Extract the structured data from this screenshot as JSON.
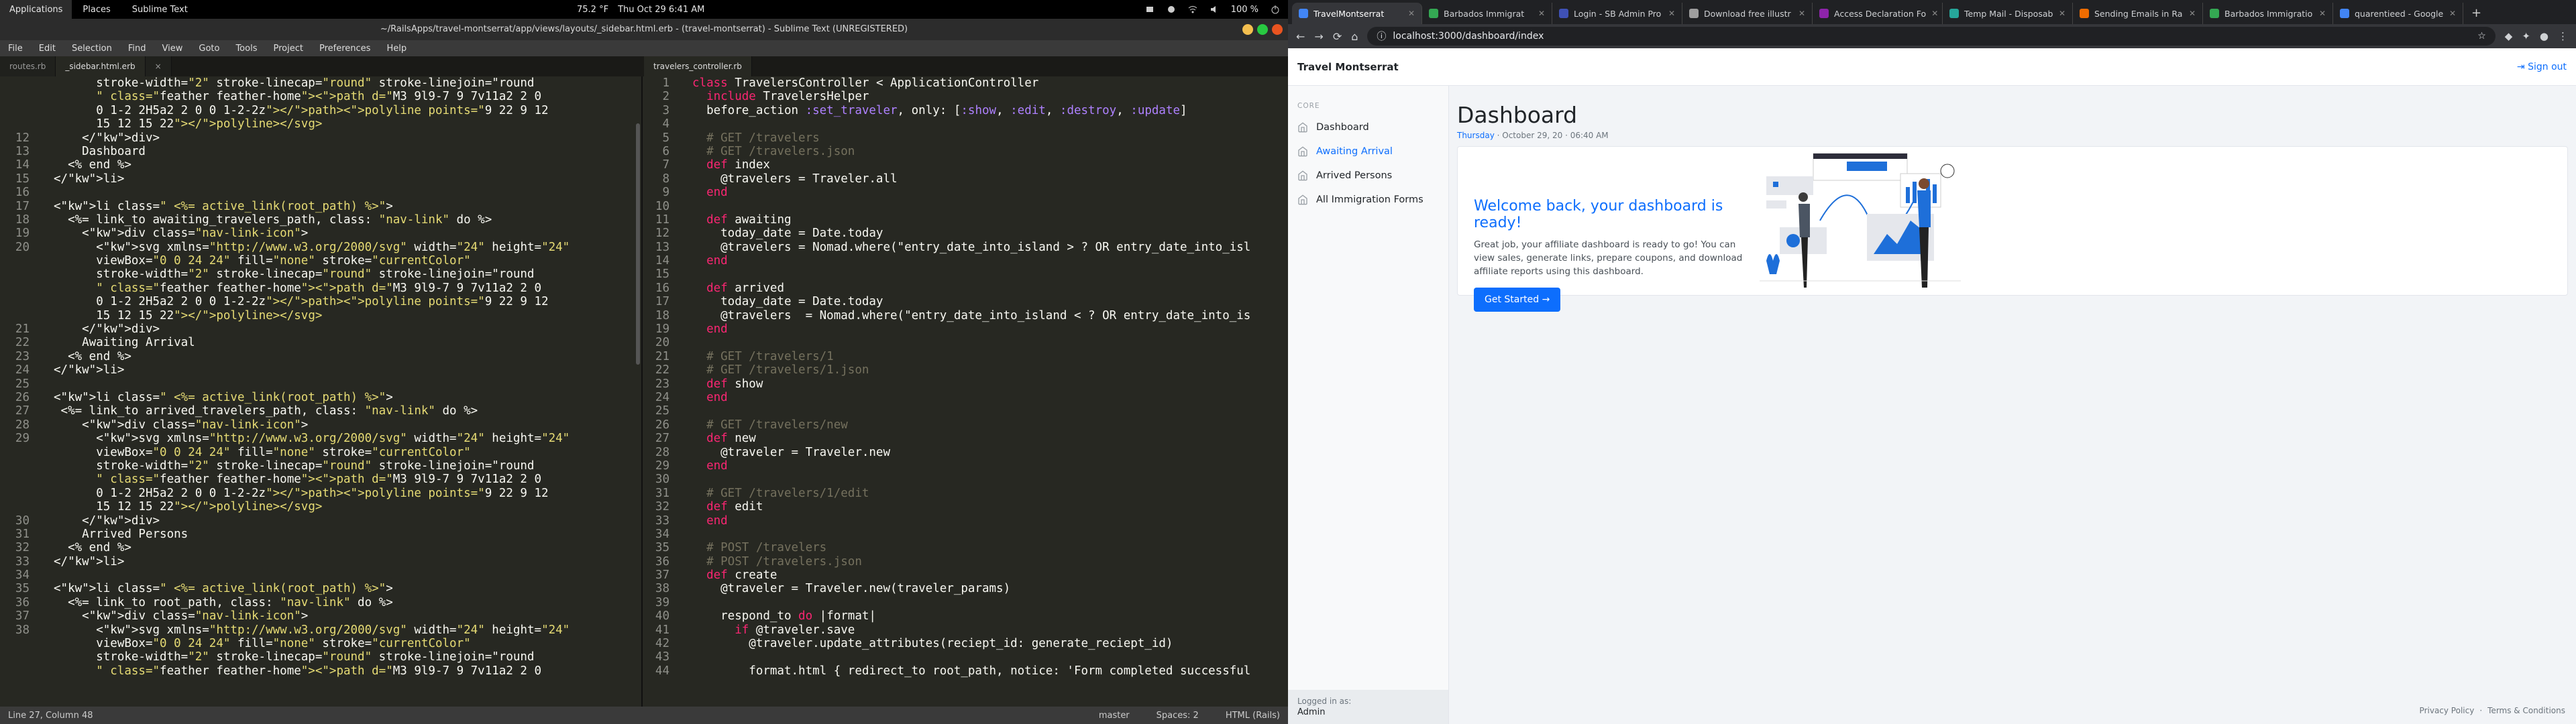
{
  "topbar": {
    "applications": "Applications",
    "places": "Places",
    "sublime": "Sublime Text",
    "weather": "75.2 °F",
    "clock": "Thu Oct 29  6:41 AM",
    "battery": "100 %"
  },
  "sublime": {
    "title": "~/RailsApps/travel-montserrat/app/views/layouts/_sidebar.html.erb - (travel-montserrat) - Sublime Text (UNREGISTERED)",
    "menu": [
      "File",
      "Edit",
      "Selection",
      "Find",
      "View",
      "Goto",
      "Tools",
      "Project",
      "Preferences",
      "Help"
    ],
    "left_tabs": [
      "routes.rb",
      "_sidebar.html.erb",
      "×"
    ],
    "right_tabs": [
      "travelers_controller.rb"
    ],
    "status": {
      "position": "Line 27, Column 48",
      "branch": "master",
      "spaces": "Spaces: 2",
      "syntax": "HTML (Rails)"
    },
    "left_lines": [
      {
        "n": "",
        "t": "      stroke-width=\"2\" stroke-linecap=\"round\" stroke-linejoin=\"round"
      },
      {
        "n": "",
        "t": "      \" class=\"feather feather-home\"><path d=\"M3 9l9-7 9 7v11a2 2 0"
      },
      {
        "n": "",
        "t": "      0 1-2 2H5a2 2 0 0 1-2-2z\"></path><polyline points=\"9 22 9 12"
      },
      {
        "n": "",
        "t": "      15 12 15 22\"></polyline></svg>"
      },
      {
        "n": "12",
        "t": "    </div>"
      },
      {
        "n": "13",
        "t": "    Dashboard"
      },
      {
        "n": "14",
        "t": "  <% end %>"
      },
      {
        "n": "15",
        "t": "</li>"
      },
      {
        "n": "16",
        "t": ""
      },
      {
        "n": "17",
        "t": "<li class=\" <%= active_link(root_path) %>\">"
      },
      {
        "n": "18",
        "t": "  <%= link_to awaiting_travelers_path, class: \"nav-link\" do %>"
      },
      {
        "n": "19",
        "t": "    <div class=\"nav-link-icon\">"
      },
      {
        "n": "20",
        "t": "      <svg xmlns=\"http://www.w3.org/2000/svg\" width=\"24\" height=\"24\""
      },
      {
        "n": "",
        "t": "      viewBox=\"0 0 24 24\" fill=\"none\" stroke=\"currentColor\""
      },
      {
        "n": "",
        "t": "      stroke-width=\"2\" stroke-linecap=\"round\" stroke-linejoin=\"round"
      },
      {
        "n": "",
        "t": "      \" class=\"feather feather-home\"><path d=\"M3 9l9-7 9 7v11a2 2 0"
      },
      {
        "n": "",
        "t": "      0 1-2 2H5a2 2 0 0 1-2-2z\"></path><polyline points=\"9 22 9 12"
      },
      {
        "n": "",
        "t": "      15 12 15 22\"></polyline></svg>"
      },
      {
        "n": "21",
        "t": "    </div>"
      },
      {
        "n": "22",
        "t": "    Awaiting Arrival"
      },
      {
        "n": "23",
        "t": "  <% end %>"
      },
      {
        "n": "24",
        "t": "</li>"
      },
      {
        "n": "25",
        "t": ""
      },
      {
        "n": "26",
        "t": "<li class=\" <%= active_link(root_path) %>\">"
      },
      {
        "n": "27",
        "t": " <%= link_to arrived_travelers_path, class: \"nav-link\" do %>"
      },
      {
        "n": "28",
        "t": "    <div class=\"nav-link-icon\">"
      },
      {
        "n": "29",
        "t": "      <svg xmlns=\"http://www.w3.org/2000/svg\" width=\"24\" height=\"24\""
      },
      {
        "n": "",
        "t": "      viewBox=\"0 0 24 24\" fill=\"none\" stroke=\"currentColor\""
      },
      {
        "n": "",
        "t": "      stroke-width=\"2\" stroke-linecap=\"round\" stroke-linejoin=\"round"
      },
      {
        "n": "",
        "t": "      \" class=\"feather feather-home\"><path d=\"M3 9l9-7 9 7v11a2 2 0"
      },
      {
        "n": "",
        "t": "      0 1-2 2H5a2 2 0 0 1-2-2z\"></path><polyline points=\"9 22 9 12"
      },
      {
        "n": "",
        "t": "      15 12 15 22\"></polyline></svg>"
      },
      {
        "n": "30",
        "t": "    </div>"
      },
      {
        "n": "31",
        "t": "    Arrived Persons"
      },
      {
        "n": "32",
        "t": "  <% end %>"
      },
      {
        "n": "33",
        "t": "</li>"
      },
      {
        "n": "34",
        "t": ""
      },
      {
        "n": "35",
        "t": "<li class=\" <%= active_link(root_path) %>\">"
      },
      {
        "n": "36",
        "t": "  <%= link_to root_path, class: \"nav-link\" do %>"
      },
      {
        "n": "37",
        "t": "    <div class=\"nav-link-icon\">"
      },
      {
        "n": "38",
        "t": "      <svg xmlns=\"http://www.w3.org/2000/svg\" width=\"24\" height=\"24\""
      },
      {
        "n": "",
        "t": "      viewBox=\"0 0 24 24\" fill=\"none\" stroke=\"currentColor\""
      },
      {
        "n": "",
        "t": "      stroke-width=\"2\" stroke-linecap=\"round\" stroke-linejoin=\"round"
      },
      {
        "n": "",
        "t": "      \" class=\"feather feather-home\"><path d=\"M3 9l9-7 9 7v11a2 2 0"
      }
    ],
    "right_lines": [
      {
        "n": "1",
        "t": "class TravelersController < ApplicationController"
      },
      {
        "n": "2",
        "t": "  include TravelersHelper"
      },
      {
        "n": "3",
        "t": "  before_action :set_traveler, only: [:show, :edit, :destroy, :update]"
      },
      {
        "n": "4",
        "t": ""
      },
      {
        "n": "5",
        "t": "  # GET /travelers"
      },
      {
        "n": "6",
        "t": "  # GET /travelers.json"
      },
      {
        "n": "7",
        "t": "  def index"
      },
      {
        "n": "8",
        "t": "    @travelers = Traveler.all"
      },
      {
        "n": "9",
        "t": "  end"
      },
      {
        "n": "10",
        "t": ""
      },
      {
        "n": "11",
        "t": "  def awaiting"
      },
      {
        "n": "12",
        "t": "    today_date = Date.today"
      },
      {
        "n": "13",
        "t": "    @travelers = Nomad.where(\"entry_date_into_island > ? OR entry_date_into_isl"
      },
      {
        "n": "14",
        "t": "  end"
      },
      {
        "n": "15",
        "t": ""
      },
      {
        "n": "16",
        "t": "  def arrived"
      },
      {
        "n": "17",
        "t": "    today_date = Date.today"
      },
      {
        "n": "18",
        "t": "    @travelers  = Nomad.where(\"entry_date_into_island < ? OR entry_date_into_is"
      },
      {
        "n": "19",
        "t": "  end"
      },
      {
        "n": "20",
        "t": ""
      },
      {
        "n": "21",
        "t": "  # GET /travelers/1"
      },
      {
        "n": "22",
        "t": "  # GET /travelers/1.json"
      },
      {
        "n": "23",
        "t": "  def show"
      },
      {
        "n": "24",
        "t": "  end"
      },
      {
        "n": "25",
        "t": ""
      },
      {
        "n": "26",
        "t": "  # GET /travelers/new"
      },
      {
        "n": "27",
        "t": "  def new"
      },
      {
        "n": "28",
        "t": "    @traveler = Traveler.new"
      },
      {
        "n": "29",
        "t": "  end"
      },
      {
        "n": "30",
        "t": ""
      },
      {
        "n": "31",
        "t": "  # GET /travelers/1/edit"
      },
      {
        "n": "32",
        "t": "  def edit"
      },
      {
        "n": "33",
        "t": "  end"
      },
      {
        "n": "34",
        "t": ""
      },
      {
        "n": "35",
        "t": "  # POST /travelers"
      },
      {
        "n": "36",
        "t": "  # POST /travelers.json"
      },
      {
        "n": "37",
        "t": "  def create"
      },
      {
        "n": "38",
        "t": "    @traveler = Traveler.new(traveler_params)"
      },
      {
        "n": "39",
        "t": ""
      },
      {
        "n": "40",
        "t": "    respond_to do |format|"
      },
      {
        "n": "41",
        "t": "      if @traveler.save"
      },
      {
        "n": "42",
        "t": "        @traveler.update_attributes(reciept_id: generate_reciept_id)"
      },
      {
        "n": "43",
        "t": ""
      },
      {
        "n": "44",
        "t": "        format.html { redirect_to root_path, notice: 'Form completed successful"
      }
    ]
  },
  "chrome": {
    "tabs": [
      {
        "label": "TravelMontserrat",
        "color": "#4285f4"
      },
      {
        "label": "Barbados Immigrat",
        "color": "#34a853"
      },
      {
        "label": "Login - SB Admin Pro",
        "color": "#3f51b5"
      },
      {
        "label": "Download free illustr",
        "color": "#9e9e9e"
      },
      {
        "label": "Access Declaration Fo",
        "color": "#8e24aa"
      },
      {
        "label": "Temp Mail - Disposab",
        "color": "#26a69a"
      },
      {
        "label": "Sending Emails in Ra",
        "color": "#ef6c00"
      },
      {
        "label": "Barbados Immigratio",
        "color": "#34a853"
      },
      {
        "label": "quarentieed - Google",
        "color": "#4285f4"
      }
    ],
    "url": "localhost:3000/dashboard/index",
    "app": {
      "brand": "Travel Montserrat",
      "signout": "Sign out",
      "nav_heading": "CORE",
      "nav": [
        {
          "label": "Dashboard",
          "active": false
        },
        {
          "label": "Awaiting Arrival",
          "active": true
        },
        {
          "label": "Arrived Persons",
          "active": false
        },
        {
          "label": "All Immigration Forms",
          "active": false
        }
      ],
      "logged_in_as": "Logged in as:",
      "user": "Admin",
      "title": "Dashboard",
      "date_dow": "Thursday",
      "date_rest": " · October 29, 20 · 06:40 AM",
      "welcome": "Welcome back, your dashboard is ready!",
      "text": "Great job, your affiliate dashboard is ready to go! You can view sales, generate links, prepare coupons, and download affiliate reports using this dashboard.",
      "cta": "Get Started",
      "footer_privacy": "Privacy Policy",
      "footer_sep": "·",
      "footer_terms": "Terms & Conditions"
    }
  }
}
